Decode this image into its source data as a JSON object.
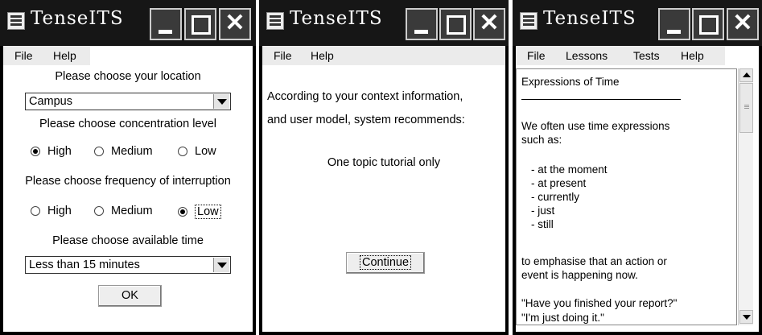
{
  "windows": [
    {
      "title": "TenseITS",
      "menu": [
        "File",
        "Help"
      ],
      "location": {
        "label": "Please choose your location",
        "value": "Campus"
      },
      "concentration": {
        "label": "Please choose concentration level",
        "options": [
          "High",
          "Medium",
          "Low"
        ],
        "selected": "High"
      },
      "interruption": {
        "label": "Please choose frequency of interruption",
        "options": [
          "High",
          "Medium",
          "Low"
        ],
        "selected": "Low"
      },
      "time": {
        "label": "Please choose available time",
        "value": "Less than 15 minutes"
      },
      "ok_label": "OK"
    },
    {
      "title": "TenseITS",
      "menu": [
        "File",
        "Help"
      ],
      "line1": "According to your context information,",
      "line2": "and user model, system recommends:",
      "recommendation": "One topic tutorial only",
      "continue_label": "Continue"
    },
    {
      "title": "TenseITS",
      "menu": [
        "File",
        "Lessons",
        "Tests",
        "Help"
      ],
      "content": {
        "heading": "Expressions of Time",
        "intro1": "We often use time expressions",
        "intro2": "such as:",
        "items": [
          "- at the moment",
          "- at present",
          "- currently",
          "- just",
          "- still"
        ],
        "outro1": "to emphasise that an action or",
        "outro2": "event is happening now.",
        "quote1": "\"Have you finished your report?\"",
        "quote2": "\"I'm just doing it.\""
      }
    }
  ]
}
